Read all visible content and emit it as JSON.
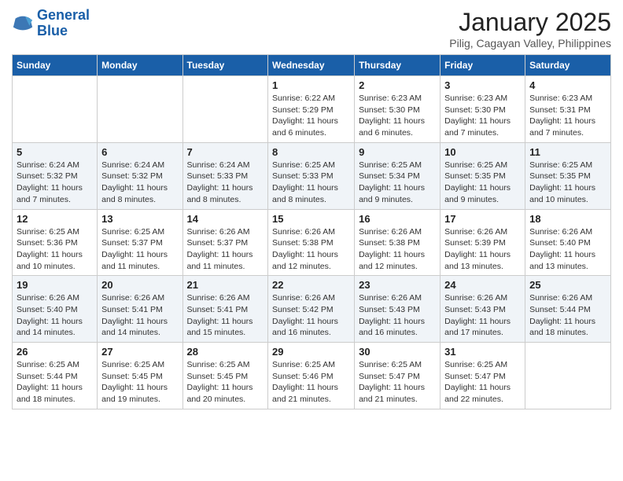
{
  "header": {
    "logo_line1": "General",
    "logo_line2": "Blue",
    "month_title": "January 2025",
    "subtitle": "Pilig, Cagayan Valley, Philippines"
  },
  "weekdays": [
    "Sunday",
    "Monday",
    "Tuesday",
    "Wednesday",
    "Thursday",
    "Friday",
    "Saturday"
  ],
  "weeks": [
    [
      {
        "day": "",
        "info": ""
      },
      {
        "day": "",
        "info": ""
      },
      {
        "day": "",
        "info": ""
      },
      {
        "day": "1",
        "info": "Sunrise: 6:22 AM\nSunset: 5:29 PM\nDaylight: 11 hours and 6 minutes."
      },
      {
        "day": "2",
        "info": "Sunrise: 6:23 AM\nSunset: 5:30 PM\nDaylight: 11 hours and 6 minutes."
      },
      {
        "day": "3",
        "info": "Sunrise: 6:23 AM\nSunset: 5:30 PM\nDaylight: 11 hours and 7 minutes."
      },
      {
        "day": "4",
        "info": "Sunrise: 6:23 AM\nSunset: 5:31 PM\nDaylight: 11 hours and 7 minutes."
      }
    ],
    [
      {
        "day": "5",
        "info": "Sunrise: 6:24 AM\nSunset: 5:32 PM\nDaylight: 11 hours and 7 minutes."
      },
      {
        "day": "6",
        "info": "Sunrise: 6:24 AM\nSunset: 5:32 PM\nDaylight: 11 hours and 8 minutes."
      },
      {
        "day": "7",
        "info": "Sunrise: 6:24 AM\nSunset: 5:33 PM\nDaylight: 11 hours and 8 minutes."
      },
      {
        "day": "8",
        "info": "Sunrise: 6:25 AM\nSunset: 5:33 PM\nDaylight: 11 hours and 8 minutes."
      },
      {
        "day": "9",
        "info": "Sunrise: 6:25 AM\nSunset: 5:34 PM\nDaylight: 11 hours and 9 minutes."
      },
      {
        "day": "10",
        "info": "Sunrise: 6:25 AM\nSunset: 5:35 PM\nDaylight: 11 hours and 9 minutes."
      },
      {
        "day": "11",
        "info": "Sunrise: 6:25 AM\nSunset: 5:35 PM\nDaylight: 11 hours and 10 minutes."
      }
    ],
    [
      {
        "day": "12",
        "info": "Sunrise: 6:25 AM\nSunset: 5:36 PM\nDaylight: 11 hours and 10 minutes."
      },
      {
        "day": "13",
        "info": "Sunrise: 6:25 AM\nSunset: 5:37 PM\nDaylight: 11 hours and 11 minutes."
      },
      {
        "day": "14",
        "info": "Sunrise: 6:26 AM\nSunset: 5:37 PM\nDaylight: 11 hours and 11 minutes."
      },
      {
        "day": "15",
        "info": "Sunrise: 6:26 AM\nSunset: 5:38 PM\nDaylight: 11 hours and 12 minutes."
      },
      {
        "day": "16",
        "info": "Sunrise: 6:26 AM\nSunset: 5:38 PM\nDaylight: 11 hours and 12 minutes."
      },
      {
        "day": "17",
        "info": "Sunrise: 6:26 AM\nSunset: 5:39 PM\nDaylight: 11 hours and 13 minutes."
      },
      {
        "day": "18",
        "info": "Sunrise: 6:26 AM\nSunset: 5:40 PM\nDaylight: 11 hours and 13 minutes."
      }
    ],
    [
      {
        "day": "19",
        "info": "Sunrise: 6:26 AM\nSunset: 5:40 PM\nDaylight: 11 hours and 14 minutes."
      },
      {
        "day": "20",
        "info": "Sunrise: 6:26 AM\nSunset: 5:41 PM\nDaylight: 11 hours and 14 minutes."
      },
      {
        "day": "21",
        "info": "Sunrise: 6:26 AM\nSunset: 5:41 PM\nDaylight: 11 hours and 15 minutes."
      },
      {
        "day": "22",
        "info": "Sunrise: 6:26 AM\nSunset: 5:42 PM\nDaylight: 11 hours and 16 minutes."
      },
      {
        "day": "23",
        "info": "Sunrise: 6:26 AM\nSunset: 5:43 PM\nDaylight: 11 hours and 16 minutes."
      },
      {
        "day": "24",
        "info": "Sunrise: 6:26 AM\nSunset: 5:43 PM\nDaylight: 11 hours and 17 minutes."
      },
      {
        "day": "25",
        "info": "Sunrise: 6:26 AM\nSunset: 5:44 PM\nDaylight: 11 hours and 18 minutes."
      }
    ],
    [
      {
        "day": "26",
        "info": "Sunrise: 6:25 AM\nSunset: 5:44 PM\nDaylight: 11 hours and 18 minutes."
      },
      {
        "day": "27",
        "info": "Sunrise: 6:25 AM\nSunset: 5:45 PM\nDaylight: 11 hours and 19 minutes."
      },
      {
        "day": "28",
        "info": "Sunrise: 6:25 AM\nSunset: 5:45 PM\nDaylight: 11 hours and 20 minutes."
      },
      {
        "day": "29",
        "info": "Sunrise: 6:25 AM\nSunset: 5:46 PM\nDaylight: 11 hours and 21 minutes."
      },
      {
        "day": "30",
        "info": "Sunrise: 6:25 AM\nSunset: 5:47 PM\nDaylight: 11 hours and 21 minutes."
      },
      {
        "day": "31",
        "info": "Sunrise: 6:25 AM\nSunset: 5:47 PM\nDaylight: 11 hours and 22 minutes."
      },
      {
        "day": "",
        "info": ""
      }
    ]
  ]
}
